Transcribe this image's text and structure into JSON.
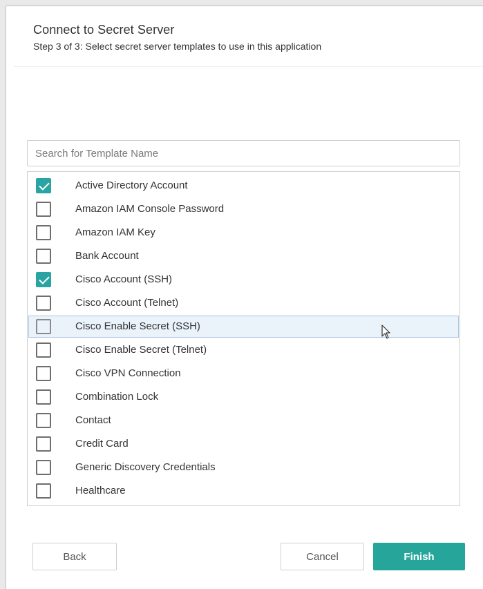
{
  "dialog": {
    "title": "Connect to Secret Server",
    "subtitle": "Step 3 of 3: Select secret server templates to use in this application"
  },
  "search": {
    "placeholder": "Search for Template Name",
    "value": ""
  },
  "templates": [
    {
      "label": "Active Directory Account",
      "checked": true
    },
    {
      "label": "Amazon IAM Console Password",
      "checked": false
    },
    {
      "label": "Amazon IAM Key",
      "checked": false
    },
    {
      "label": "Bank Account",
      "checked": false
    },
    {
      "label": "Cisco Account (SSH)",
      "checked": true
    },
    {
      "label": "Cisco Account (Telnet)",
      "checked": false
    },
    {
      "label": "Cisco Enable Secret (SSH)",
      "checked": false,
      "hovered": true
    },
    {
      "label": "Cisco Enable Secret (Telnet)",
      "checked": false
    },
    {
      "label": "Cisco VPN Connection",
      "checked": false
    },
    {
      "label": "Combination Lock",
      "checked": false
    },
    {
      "label": "Contact",
      "checked": false
    },
    {
      "label": "Credit Card",
      "checked": false
    },
    {
      "label": "Generic Discovery Credentials",
      "checked": false
    },
    {
      "label": "Healthcare",
      "checked": false
    }
  ],
  "buttons": {
    "back": "Back",
    "cancel": "Cancel",
    "finish": "Finish"
  },
  "colors": {
    "accent": "#26a69a",
    "checkbox_checked": "#2aa3a3",
    "hover_row": "#eaf2fa"
  },
  "icons": {
    "checkbox_checked": "check-icon",
    "cursor": "mouse-pointer-icon"
  }
}
